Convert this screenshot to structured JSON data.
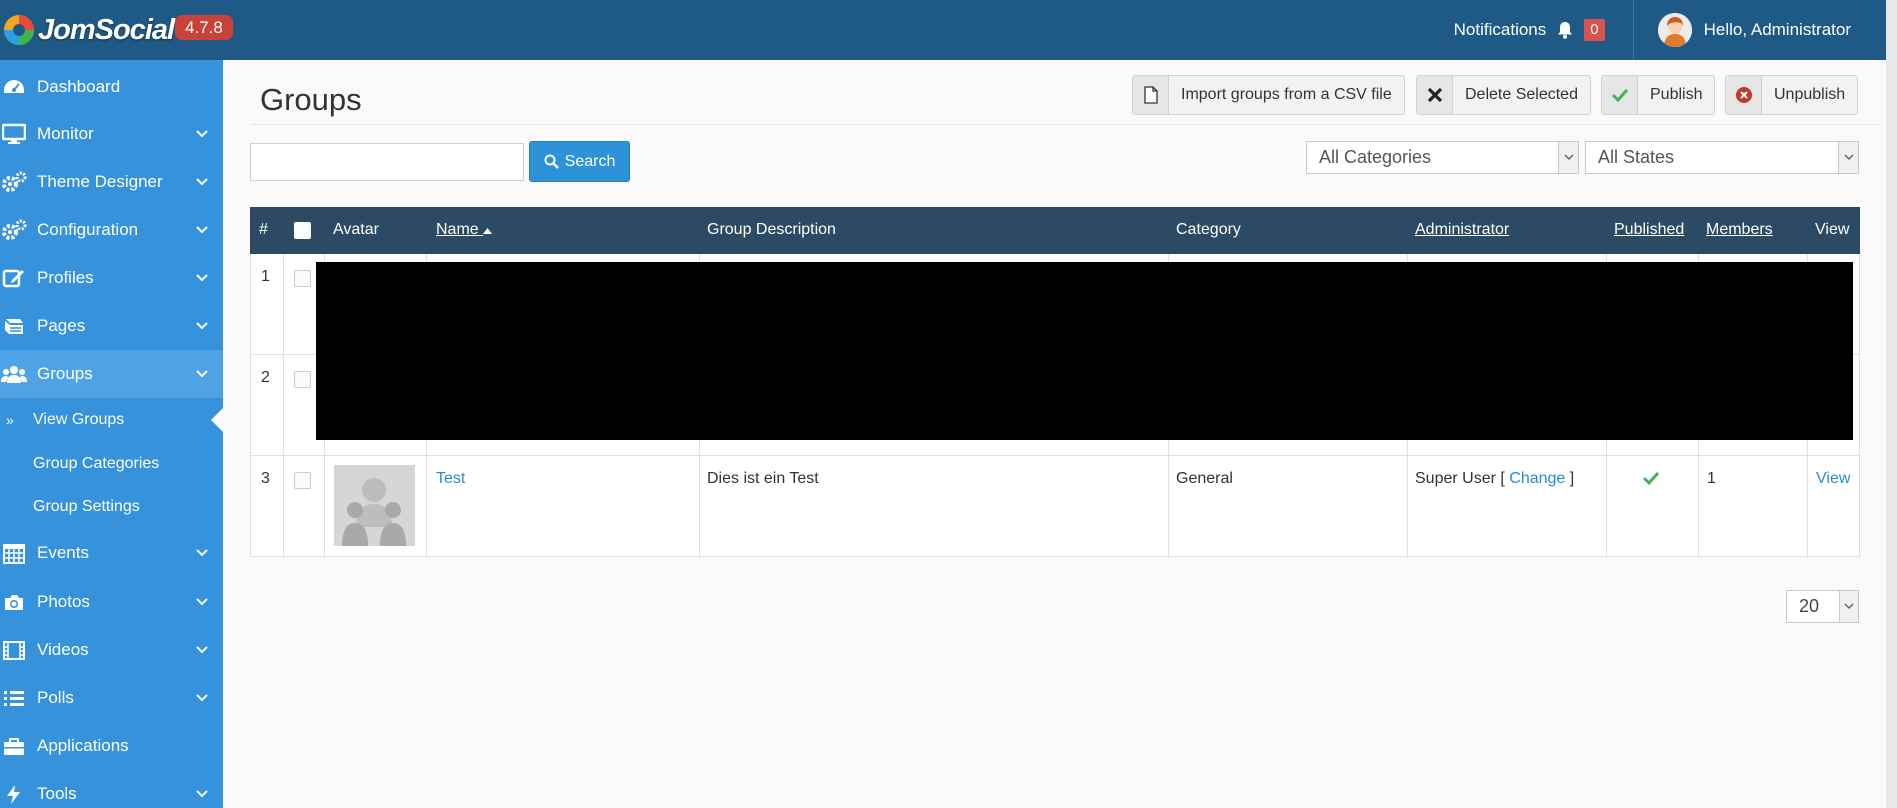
{
  "app": {
    "brand": "JomSocial",
    "version": "4.7.8"
  },
  "topbar": {
    "notifications_label": "Notifications",
    "notifications_count": "0",
    "greeting": "Hello, Administrator"
  },
  "sidebar": {
    "items": [
      {
        "label": "Dashboard",
        "icon": "dashboard-icon"
      },
      {
        "label": "Monitor",
        "icon": "monitor-icon"
      },
      {
        "label": "Theme Designer",
        "icon": "gears-icon"
      },
      {
        "label": "Configuration",
        "icon": "gears-icon"
      },
      {
        "label": "Profiles",
        "icon": "edit-icon"
      },
      {
        "label": "Pages",
        "icon": "book-icon"
      },
      {
        "label": "Groups",
        "icon": "users-icon"
      },
      {
        "label": "Events",
        "icon": "calendar-icon"
      },
      {
        "label": "Photos",
        "icon": "camera-icon"
      },
      {
        "label": "Videos",
        "icon": "film-icon"
      },
      {
        "label": "Polls",
        "icon": "list-icon"
      },
      {
        "label": "Applications",
        "icon": "briefcase-icon"
      },
      {
        "label": "Tools",
        "icon": "bolt-icon"
      }
    ],
    "groups_sub": [
      {
        "label": "View Groups"
      },
      {
        "label": "Group Categories"
      },
      {
        "label": "Group Settings"
      }
    ]
  },
  "page": {
    "title": "Groups"
  },
  "toolbar": {
    "import_label": "Import groups from a CSV file",
    "delete_label": "Delete Selected",
    "publish_label": "Publish",
    "unpublish_label": "Unpublish"
  },
  "search": {
    "value": "",
    "button_label": "Search"
  },
  "filters": {
    "category_selected": "All Categories",
    "state_selected": "All States"
  },
  "table": {
    "headers": {
      "num": "#",
      "avatar": "Avatar",
      "name": "Name",
      "description": "Group Description",
      "category": "Category",
      "administrator": "Administrator",
      "published": "Published",
      "members": "Members",
      "view": "View"
    },
    "rows": [
      {
        "num": "1"
      },
      {
        "num": "2"
      },
      {
        "num": "3",
        "name": "Test",
        "description": "Dies ist ein Test",
        "category": "General",
        "admin_name": "Super User",
        "admin_open": "[",
        "admin_change": "Change",
        "admin_close": "]",
        "published": true,
        "members": "1",
        "view": "View"
      }
    ]
  },
  "pagination": {
    "per_page": "20"
  },
  "colors": {
    "topbar": "#1f5a86",
    "sidebar": "#3592db",
    "table_header": "#2c4a63",
    "accent": "#2a8bd0",
    "badge": "#c9423a"
  }
}
